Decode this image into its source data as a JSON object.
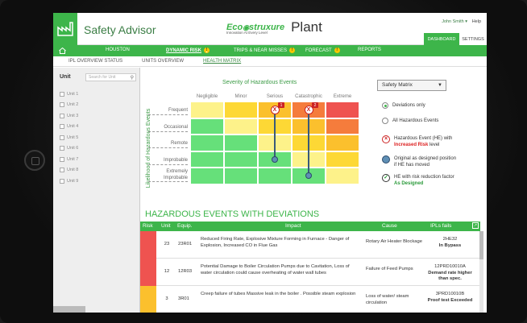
{
  "app": {
    "title": "Safety Advisor",
    "brand_eco": "Eco",
    "brand_struxure": "struxure",
    "brand_tagline": "Innovation At Every Level",
    "brand_product": "Plant",
    "user": "John Smith ▾",
    "help": "Help"
  },
  "header_tabs": {
    "dashboard": "DASHBOARD",
    "settings": "SETTINGS"
  },
  "nav": {
    "items": [
      {
        "label": "HOUSTON",
        "warn": false
      },
      {
        "label": "DYNAMIC RISK",
        "warn": true,
        "active": true
      },
      {
        "label": "TRIPS & NEAR MISSES",
        "warn": true
      },
      {
        "label": "FORECAST",
        "warn": true
      },
      {
        "label": "REPORTS",
        "warn": false
      }
    ],
    "warn_glyph": "!"
  },
  "subnav": {
    "items": [
      {
        "label": "IPL OVERVIEW STATUS"
      },
      {
        "label": "UNITS OVERVIEW"
      },
      {
        "label": "HEALTH MATRIX",
        "active": true
      }
    ]
  },
  "sidebar": {
    "heading": "Unit",
    "search_placeholder": "Search for Unit",
    "units": [
      "Unit 1",
      "Unit 2",
      "Unit 3",
      "Unit 4",
      "Unit 5",
      "Unit 6",
      "Unit 7",
      "Unit 8",
      "Unit 9"
    ]
  },
  "matrix": {
    "severity_title": "Severity of Hazardous Events",
    "likelihood_title": "Likelihood of Hazardous Events",
    "columns": [
      "Negligible",
      "Minor",
      "Serious",
      "Catastrophic",
      "Extreme"
    ],
    "rows": [
      "Frequent",
      "Occasional",
      "Remote",
      "Improbable",
      "Extremely Improbable"
    ],
    "colors": [
      [
        "#fdf28a",
        "#fdd835",
        "#fbc02d",
        "#f57c3c",
        "#ef5350"
      ],
      [
        "#66e07a",
        "#fdf28a",
        "#fdd835",
        "#fbc02d",
        "#f57c3c"
      ],
      [
        "#66e07a",
        "#66e07a",
        "#fdf28a",
        "#fdd835",
        "#fbc02d"
      ],
      [
        "#66e07a",
        "#66e07a",
        "#66e07a",
        "#fdf28a",
        "#fdd835"
      ],
      [
        "#66e07a",
        "#66e07a",
        "#66e07a",
        "#66e07a",
        "#fdf28a"
      ]
    ],
    "markers": [
      {
        "col": 2,
        "row": 0,
        "count": "1",
        "to_row": 3
      },
      {
        "col": 3,
        "row": 0,
        "count": "2",
        "to_row": 4
      }
    ],
    "marker_glyph": "X"
  },
  "controls": {
    "select_value": "Safety Matrix",
    "radio_deviations": "Deviations only",
    "radio_all": "All Hazardous Events"
  },
  "legend": {
    "he_line1": "Hazardous Event (HE) with",
    "he_red": "Increased Risk",
    "he_line2": " level",
    "orig_line1": "Original as designed position",
    "orig_line2": "if HE has moved",
    "rr_line1": "HE with risk reduction factor",
    "rr_green": "As Designed"
  },
  "table": {
    "title": "HAZARDOUS EVENTS WITH DEVIATIONS",
    "headers": [
      "Risk",
      "Unit",
      "Equip.",
      "Impact",
      "Cause",
      "IPLs fails"
    ],
    "rows": [
      {
        "risk_color": "#ef5350",
        "unit": "23",
        "equip": "23R01",
        "impact": "Reduced Firing Rate, Explosive Mixture Forming in Furnace - Danger of Explosion, Increased CO in Flue Gas",
        "cause": "Rotary Air Heater Blockage",
        "ipl1": "2HE32",
        "ipl2": "In Bypass"
      },
      {
        "risk_color": "#ef5350",
        "unit": "12",
        "equip": "12R03",
        "impact": "Potential Damage to Boiler Circulation Pumps due to Cavitation, Loss of water circulation could cause overheating of water wall tubes",
        "cause": "Failure of Feed Pumps",
        "ipl1": "12PRD10010A",
        "ipl2": "Demand rate higher than spec."
      },
      {
        "risk_color": "#fbc02d",
        "unit": "3",
        "equip": "3R01",
        "impact": "Creep  failure of tubes Massive leak in the boiler . Possible steam explosion",
        "cause": "Loss of water/ steam circulation",
        "ipl1": "3PRD10010B",
        "ipl2": "Proof test Exceeded"
      }
    ]
  }
}
